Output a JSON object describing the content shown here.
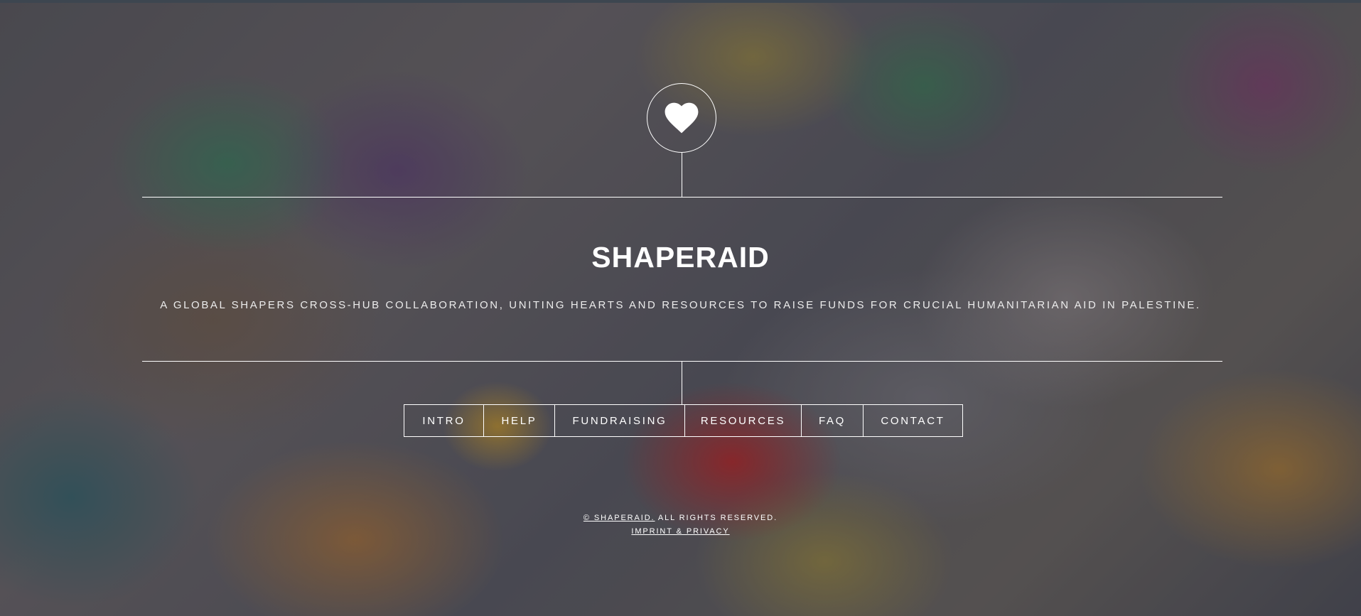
{
  "site": {
    "title": "SHAPERAID",
    "tagline": "A GLOBAL SHAPERS CROSS-HUB COLLABORATION, UNITING HEARTS AND RESOURCES TO RAISE FUNDS FOR CRUCIAL HUMANITARIAN AID IN PALESTINE.",
    "logo_icon": "heart-icon"
  },
  "nav": {
    "items": [
      {
        "label": "INTRO"
      },
      {
        "label": "HELP"
      },
      {
        "label": "FUNDRAISING"
      },
      {
        "label": "RESOURCES"
      },
      {
        "label": "FAQ"
      },
      {
        "label": "CONTACT"
      }
    ]
  },
  "footer": {
    "copyright_link": "© SHAPERAID.",
    "rights_text": " ALL RIGHTS RESERVED.",
    "imprint_link": "IMPRINT & PRIVACY"
  },
  "colors": {
    "text": "#ffffff",
    "lines": "#ffffff",
    "top_bar": "#3d4650"
  }
}
